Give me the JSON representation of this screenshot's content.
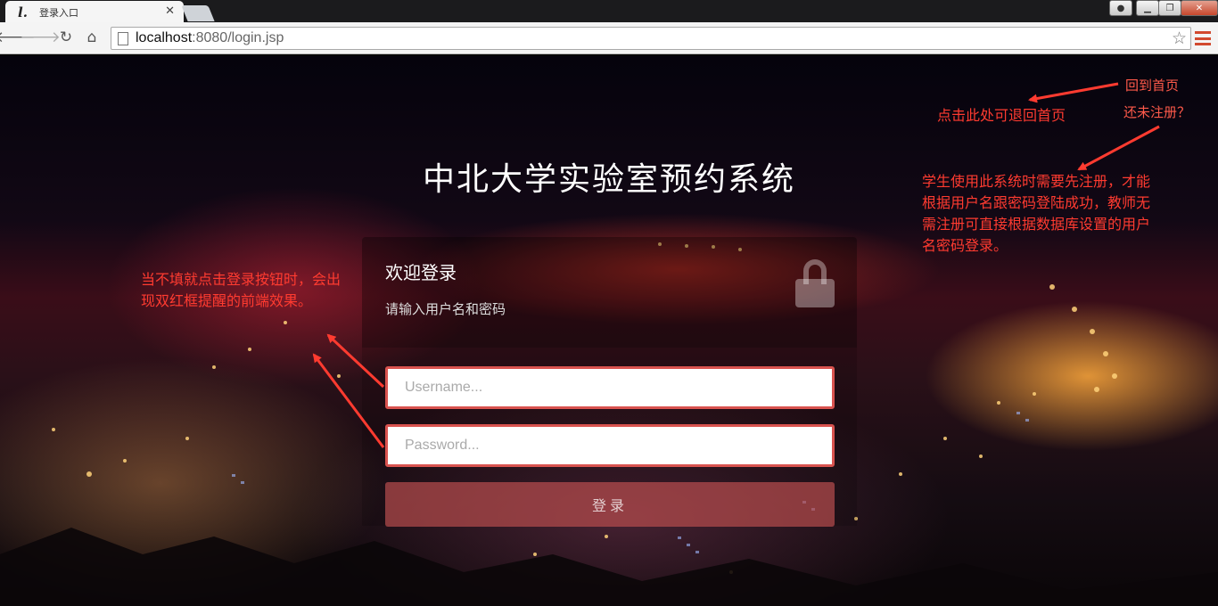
{
  "browser": {
    "tab_title": "登录入口",
    "tab_favicon": "l.",
    "tab_close": "✕",
    "url_host": "localhost",
    "url_rest": ":8080/login.jsp",
    "icons": [
      "back-arrow-icon",
      "forward-arrow-icon",
      "reload-icon",
      "home-icon",
      "page-icon",
      "star-icon",
      "menu-icon"
    ]
  },
  "page": {
    "system_title": "中北大学实验室预约系统",
    "login": {
      "welcome": "欢迎登录",
      "hint": "请输入用户名和密码",
      "username_placeholder": "Username...",
      "password_placeholder": "Password...",
      "submit_label": "登录"
    },
    "annotations": {
      "left_note": "当不填就点击登录按钮时，会出现双红框提醒的前端效果。",
      "back_home_hint": "点击此处可退回首页",
      "home_link": "回到首页",
      "register_link": "还未注册？",
      "register_note": "学生使用此系统时需要先注册，才能根据用户名跟密码登陆成功，教师无需注册可直接根据数据库设置的用户名密码登录。"
    }
  },
  "colors": {
    "annotation_red": "#ff3b30",
    "field_border_red": "#d9534f",
    "button_bg": "rgba(205,85,85,0.62)"
  }
}
